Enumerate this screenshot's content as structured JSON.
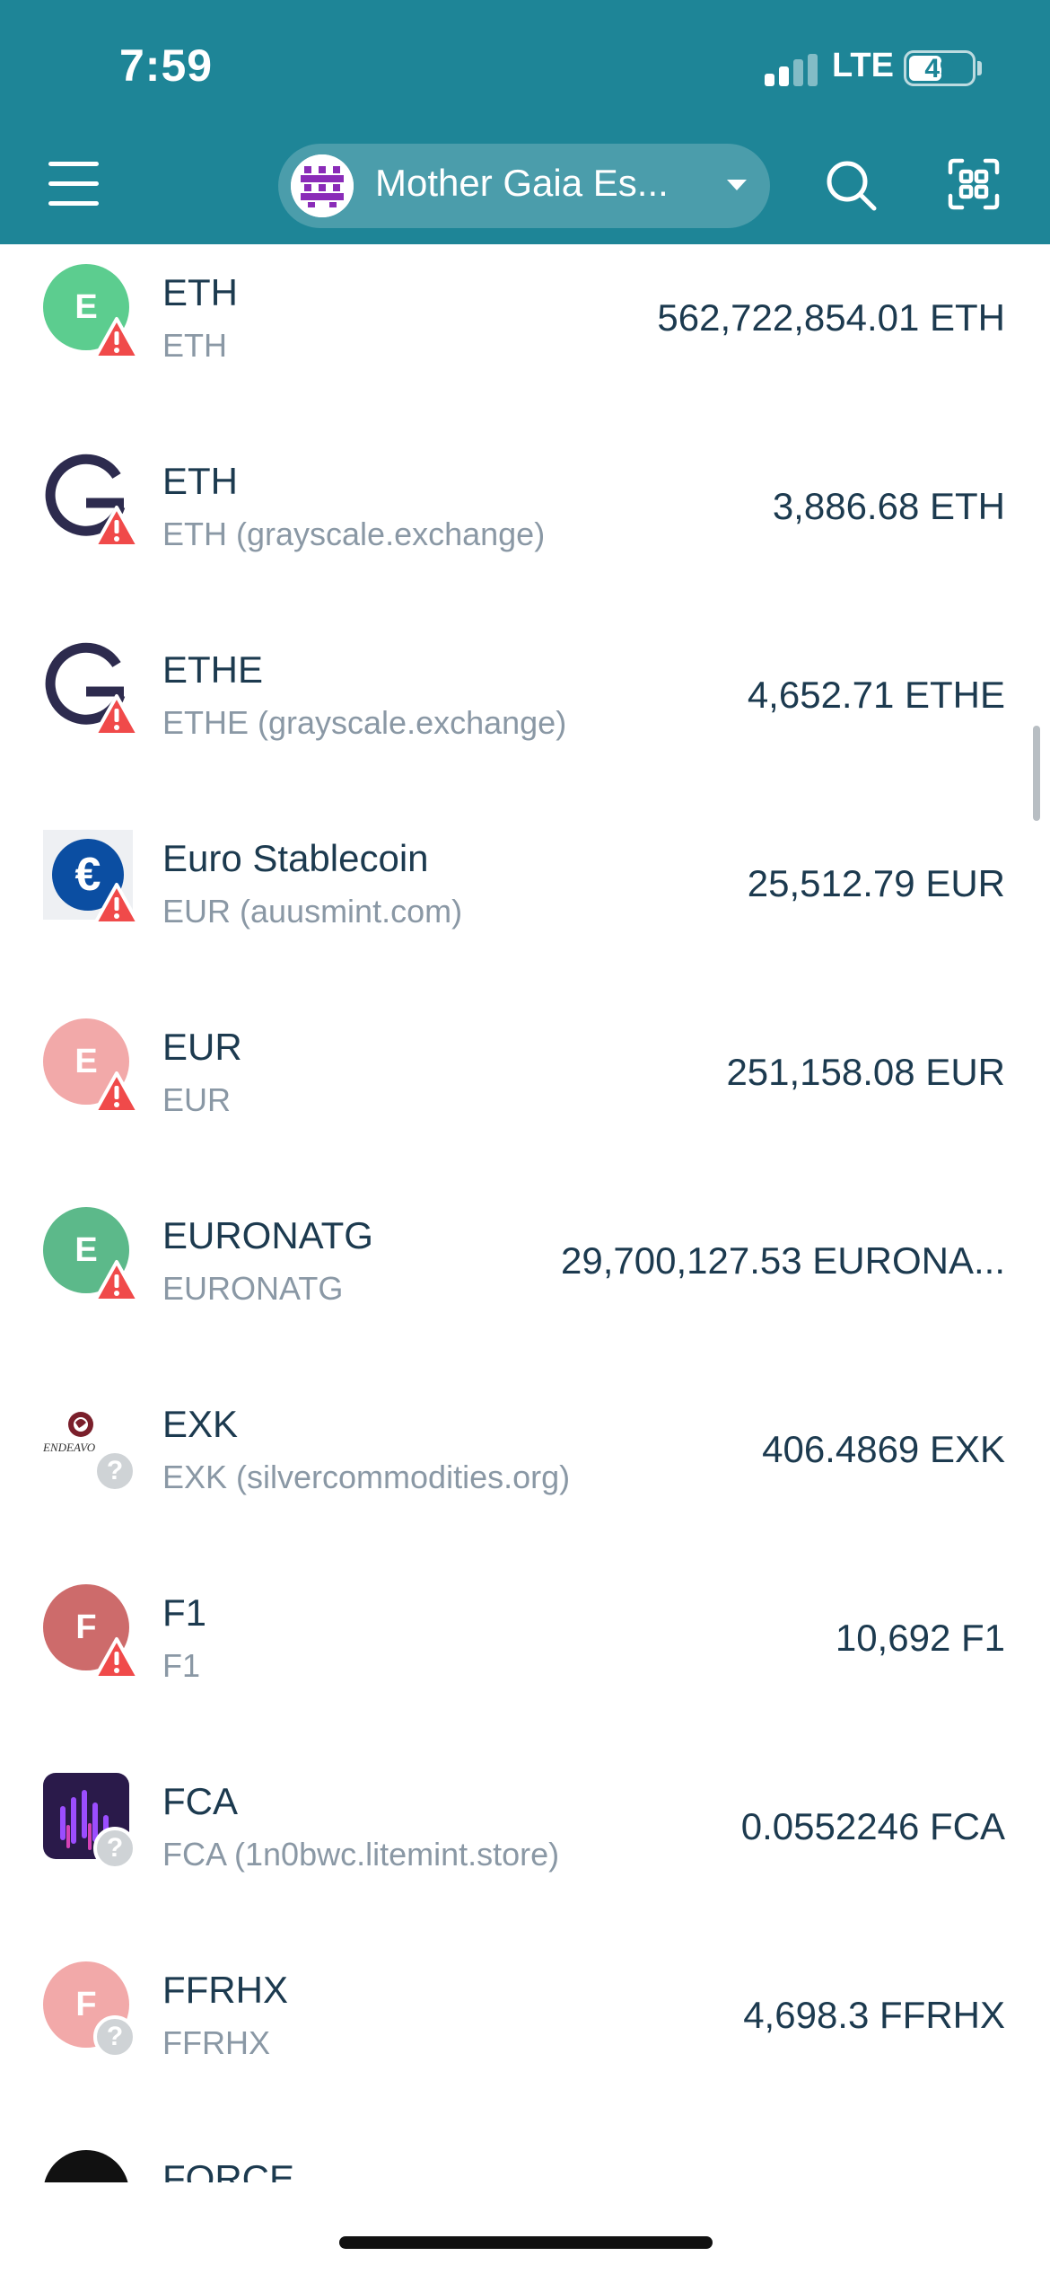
{
  "status_bar": {
    "time": "7:59",
    "network": "LTE",
    "battery": "49"
  },
  "header": {
    "account_name": "Mother Gaia Es...",
    "icons": {
      "menu": "hamburger-icon",
      "search": "search-icon",
      "scan": "qr-scan-icon",
      "dropdown": "chevron-down-icon"
    }
  },
  "assets": [
    {
      "name": "ETH",
      "subtitle": "ETH",
      "amount": "562,722,854.01 ETH",
      "icon_letter": "E",
      "icon_color": "#5ccd8f",
      "badge": "warning"
    },
    {
      "name": "ETH",
      "subtitle": "ETH (grayscale.exchange)",
      "amount": "3,886.68 ETH",
      "icon_letter": "",
      "icon_color": "#2d2b4e",
      "badge": "warning",
      "icon_type": "grayscale-logo"
    },
    {
      "name": "ETHE",
      "subtitle": "ETHE (grayscale.exchange)",
      "amount": "4,652.71 ETHE",
      "icon_letter": "",
      "icon_color": "#2d2b4e",
      "badge": "warning",
      "icon_type": "grayscale-logo"
    },
    {
      "name": "Euro Stablecoin",
      "subtitle": "EUR (auusmint.com)",
      "amount": "25,512.79 EUR",
      "icon_letter": "€",
      "icon_color": "#0b4ea2",
      "badge": "warning",
      "icon_type": "euro-coin-logo"
    },
    {
      "name": "EUR",
      "subtitle": "EUR",
      "amount": "251,158.08 EUR",
      "icon_letter": "E",
      "icon_color": "#f2a9a9",
      "badge": "warning"
    },
    {
      "name": "EURONATG",
      "subtitle": "EURONATG",
      "amount": "29,700,127.53 EURONA...",
      "icon_letter": "E",
      "icon_color": "#5cb98a",
      "badge": "warning"
    },
    {
      "name": "EXK",
      "subtitle": "EXK (silvercommodities.org)",
      "amount": "406.4869 EXK",
      "icon_letter": "ENDEAVO",
      "icon_color": "#7a1f2b",
      "badge": "unknown",
      "icon_type": "endeavour-logo"
    },
    {
      "name": "F1",
      "subtitle": "F1",
      "amount": "10,692 F1",
      "icon_letter": "F",
      "icon_color": "#cd6b6b",
      "badge": "warning"
    },
    {
      "name": "FCA",
      "subtitle": "FCA (1n0bwc.litemint.store)",
      "amount": "0.0552246 FCA",
      "icon_letter": "",
      "icon_color": "#2a1a4a",
      "badge": "unknown",
      "icon_type": "fca-logo"
    },
    {
      "name": "FFRHX",
      "subtitle": "FFRHX",
      "amount": "4,698.3 FFRHX",
      "icon_letter": "F",
      "icon_color": "#f2a9a9",
      "badge": "unknown"
    },
    {
      "name": "FORCE",
      "subtitle": "",
      "amount": "",
      "icon_letter": "",
      "icon_color": "#111111",
      "badge": "none",
      "icon_type": "force-logo"
    }
  ],
  "colors": {
    "header_bg": "#1e8597",
    "text_primary": "#1c3a4f",
    "text_secondary": "#8a98a5",
    "warning": "#f04a4a"
  }
}
